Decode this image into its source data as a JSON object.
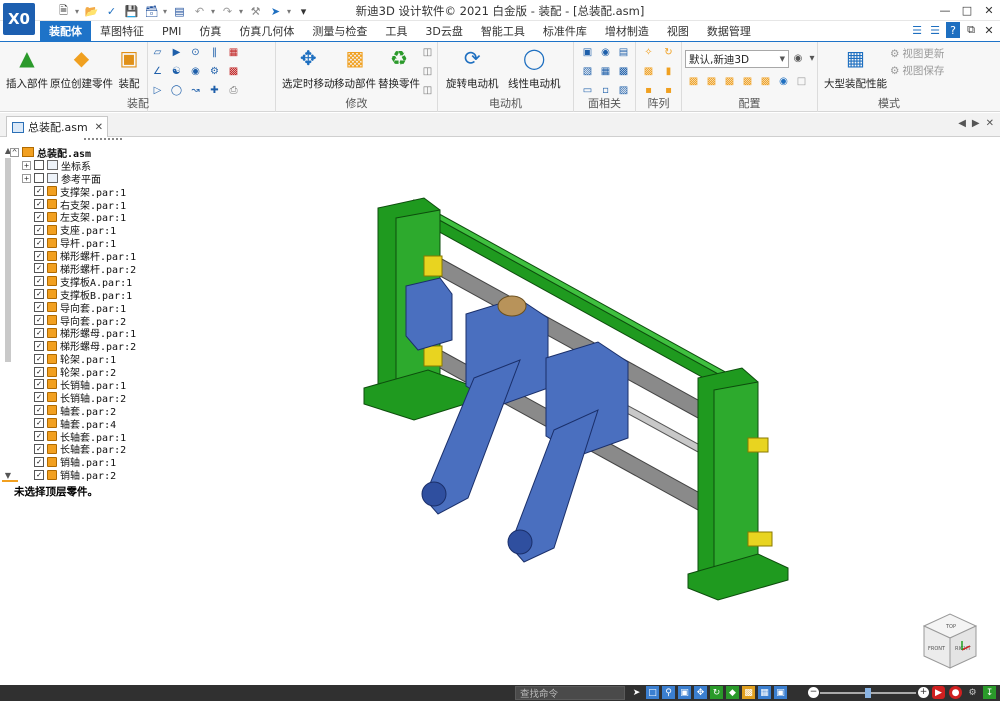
{
  "window": {
    "title": "新迪3D 设计软件© 2021 白金版 - 装配 - [总装配.asm]",
    "logo": "X0"
  },
  "quick_access": [
    "new-icon",
    "open-icon",
    "folder-icon",
    "save-icon",
    "save-as-icon",
    "table-icon",
    "undo-icon",
    "redo-icon",
    "select-icon",
    "customize-icon"
  ],
  "tabs": [
    "装配体",
    "草图特征",
    "PMI",
    "仿真",
    "仿真几何体",
    "测量与检查",
    "工具",
    "3D云盘",
    "智能工具",
    "标准件库",
    "增材制造",
    "视图",
    "数据管理"
  ],
  "active_tab": 0,
  "ribbon": {
    "assembly": {
      "label": "装配",
      "insert_part": "插入部件",
      "create_in_place": "原位创建零件",
      "assemble": "装配"
    },
    "modify": {
      "label": "修改",
      "move_selected": "选定时移动",
      "move_part": "移动部件",
      "replace_part": "替换零件"
    },
    "motor": {
      "label": "电动机",
      "rotary_motor": "旋转电动机",
      "linear_motor": "线性电动机"
    },
    "face_related": {
      "label": "面相关"
    },
    "pattern": {
      "label": "阵列"
    },
    "config": {
      "label": "配置",
      "selected": "默认,新迪3D"
    },
    "mode": {
      "label": "模式",
      "large_assembly": "大型装配性能",
      "limited_update": "视图更新",
      "limited_save": "视图保存"
    }
  },
  "document_tab": {
    "name": "总装配.asm"
  },
  "tree": {
    "root": "总装配.asm",
    "features": [
      "坐标系",
      "参考平面"
    ],
    "parts": [
      "支撑架.par:1",
      "右支架.par:1",
      "左支架.par:1",
      "支座.par:1",
      "导杆.par:1",
      "梯形螺杆.par:1",
      "梯形螺杆.par:2",
      "支撑板A.par:1",
      "支撑板B.par:1",
      "导向套.par:1",
      "导向套.par:2",
      "梯形螺母.par:1",
      "梯形螺母.par:2",
      "轮架.par:1",
      "轮架.par:2",
      "长销轴.par:1",
      "长销轴.par:2",
      "轴套.par:2",
      "轴套.par:4",
      "长轴套.par:1",
      "长轴套.par:2",
      "销轴.par:1",
      "销轴.par:2"
    ],
    "status": "未选择顶层零件。"
  },
  "view_cube": {
    "top": "TOP",
    "front": "FRONT",
    "right": "RIGHT"
  },
  "statusbar": {
    "search_placeholder": "查找命令",
    "zoom": 0.5
  },
  "colors": {
    "accent": "#1e73c8",
    "frame_green": "#1f9a1f",
    "part_blue": "#4a6fbf"
  }
}
